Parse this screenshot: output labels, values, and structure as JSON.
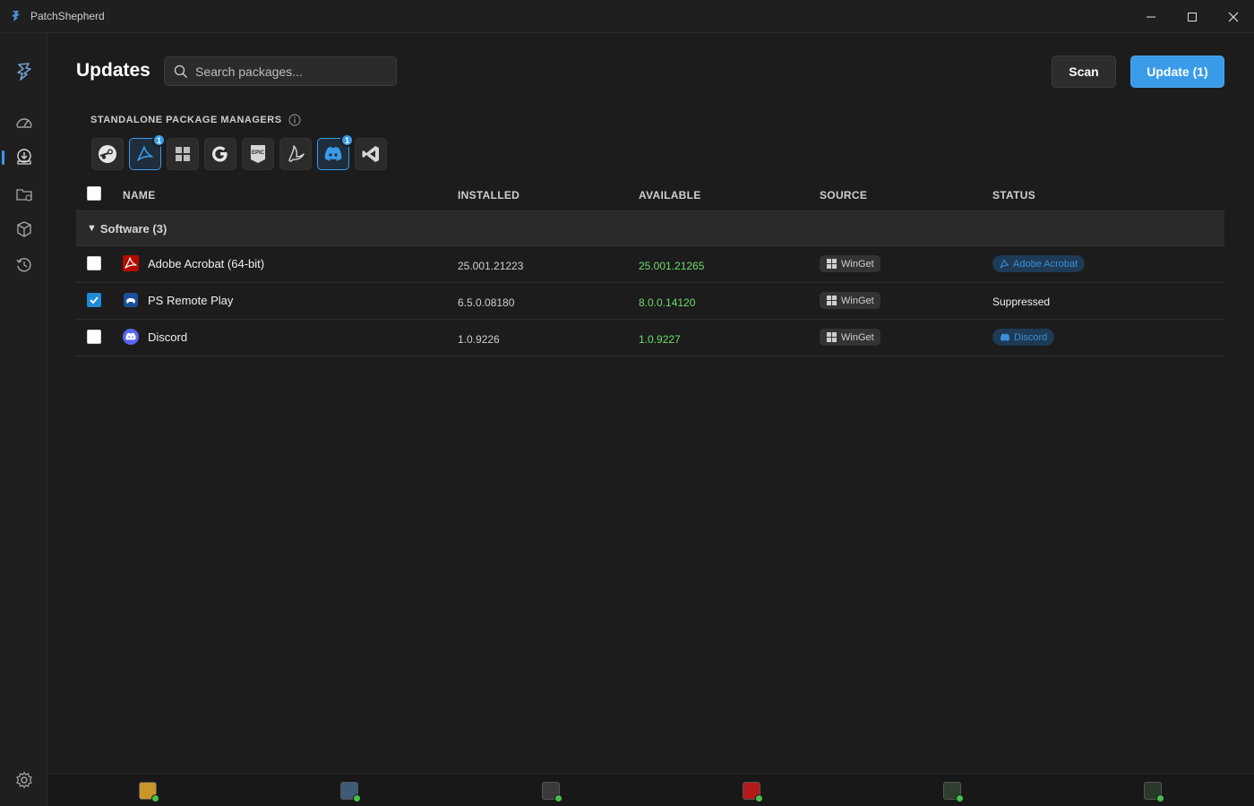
{
  "window": {
    "title": "PatchShepherd"
  },
  "sidebar": {
    "items": [
      {
        "icon": "shepherd-logo-icon"
      },
      {
        "icon": "speedometer-icon"
      },
      {
        "icon": "updates-icon",
        "active": true
      },
      {
        "icon": "folder-icon"
      },
      {
        "icon": "packages-icon"
      },
      {
        "icon": "history-icon"
      }
    ],
    "settings_icon": "gear-icon"
  },
  "header": {
    "title": "Updates",
    "search_placeholder": "Search packages...",
    "scan_label": "Scan",
    "update_label": "Update (1)"
  },
  "package_managers": {
    "label": "STANDALONE PACKAGE MANAGERS",
    "items": [
      {
        "name": "steam-icon"
      },
      {
        "name": "adobe-acrobat-icon",
        "selected": true,
        "badge": "1"
      },
      {
        "name": "windows-icon"
      },
      {
        "name": "google-icon"
      },
      {
        "name": "epic-games-icon"
      },
      {
        "name": "battle-net-icon"
      },
      {
        "name": "discord-icon",
        "selected": true,
        "badge": "1"
      },
      {
        "name": "visual-studio-icon"
      }
    ]
  },
  "table": {
    "columns": {
      "name": "NAME",
      "installed": "INSTALLED",
      "available": "AVAILABLE",
      "source": "SOURCE",
      "status": "STATUS"
    },
    "group_label": "Software (3)",
    "rows": [
      {
        "name": "Adobe Acrobat (64-bit)",
        "installed": "25.001.21223",
        "available": "25.001.21265",
        "source": "WinGet",
        "status": "Adobe Acrobat",
        "checked": false
      },
      {
        "name": "PS Remote Play",
        "installed": "6.5.0.08180",
        "available": "8.0.0.14120",
        "source": "WinGet",
        "status": "Suppressed",
        "checked": true
      },
      {
        "name": "Discord",
        "installed": "1.0.9226",
        "available": "1.0.9227",
        "source": "WinGet",
        "status": "Discord",
        "checked": false
      }
    ]
  },
  "colors": {
    "accent": "#3a9be9",
    "available_version": "#6ddc6d",
    "background": "#1c1c1c"
  }
}
